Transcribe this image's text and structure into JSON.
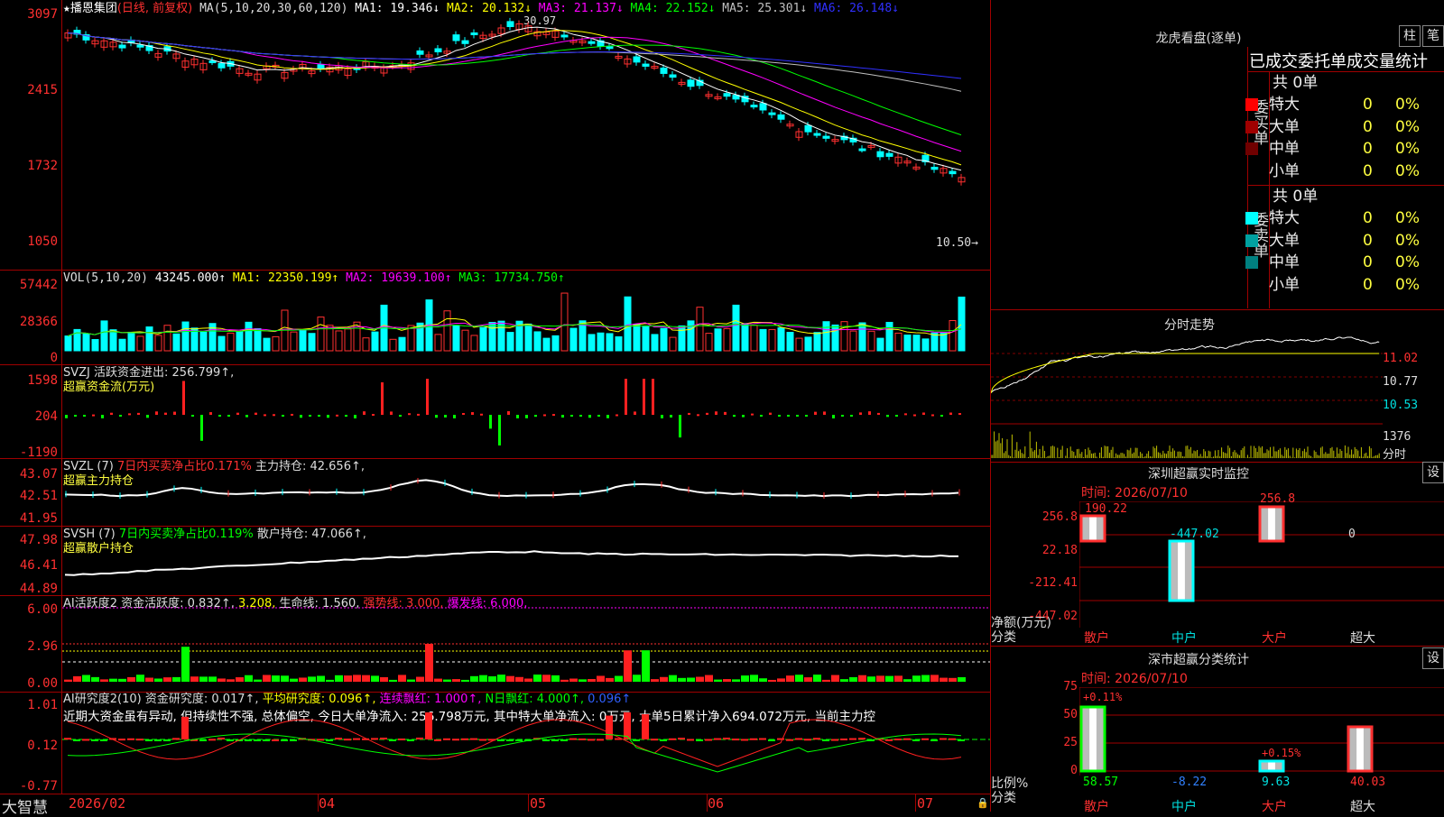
{
  "kline": {
    "title": "播恩集团",
    "period": "(日线, 前复权)",
    "ma_header": "MA(5,10,20,30,60,120)",
    "ma": [
      {
        "label": "MA1: 19.346↓",
        "color": "#ffffff"
      },
      {
        "label": "MA2: 20.132↓",
        "color": "#ffff00"
      },
      {
        "label": "MA3: 21.137↓",
        "color": "#ff00ff"
      },
      {
        "label": "MA4: 22.152↓",
        "color": "#00ff00"
      },
      {
        "label": "MA5: 25.301↓",
        "color": "#c0c0c0"
      },
      {
        "label": "MA6: 26.148↓",
        "color": "#3030ff"
      }
    ],
    "y_ticks": [
      "3097",
      "2415",
      "1732",
      "1050"
    ],
    "high_label": "30.97",
    "last_label": "10.50→"
  },
  "vol": {
    "header": "VOL(5,10,20)",
    "value": "43245.000↑",
    "ma": [
      {
        "label": "MA1: 22350.199↑",
        "color": "#ffff00"
      },
      {
        "label": "MA2: 19639.100↑",
        "color": "#ff00ff"
      },
      {
        "label": "MA3: 17734.750↑",
        "color": "#00ff00"
      }
    ],
    "y_ticks": [
      "57442",
      "28366",
      "0"
    ]
  },
  "svzj": {
    "header": "SVZJ  活跃资金进出: 256.799↑,",
    "sub": "超赢资金流(万元)",
    "y_ticks": [
      "1598",
      "204",
      "-1190"
    ]
  },
  "svzl": {
    "header_a": "SVZL (7)",
    "header_b": "7日内买卖净占比0.171%",
    "header_c": "主力持仓: 42.656↑,",
    "sub": "超赢主力持仓",
    "y_ticks": [
      "43.07",
      "42.51",
      "41.95"
    ]
  },
  "svsh": {
    "header_a": "SVSH (7)",
    "header_b": "7日内买卖净占比0.119%",
    "header_c": "散户持仓: 47.066↑,",
    "sub": "超赢散户持仓",
    "y_ticks": [
      "47.98",
      "46.41",
      "44.89"
    ]
  },
  "ai1": {
    "header_a": "AI活跃度2 资金活跃度: 0.832↑,",
    "header_b": "3.208,",
    "header_c": "生命线: 1.560,",
    "header_d": "强势线: 3.000,",
    "header_e": "爆发线: 6.000,",
    "y_ticks": [
      "6.00",
      "2.96",
      "0.00"
    ]
  },
  "ai2": {
    "header_a": "AI研究度2(10) 资金研究度: 0.017↑,",
    "header_b": "平均研究度: 0.096↑,",
    "header_c": "连续飘红: 1.000↑,",
    "header_d": "N日飘红: 4.000↑,",
    "header_e": "0.096↑",
    "commentary": "近期大资金虽有异动, 但持续性不强, 总体偏空, 今日大单净流入: 256.798万元, 其中特大单净流入: 0万元, 大单5日累计净入694.072万元, 当前主力控",
    "y_ticks": [
      "1.01",
      "0.12",
      "-0.77"
    ]
  },
  "bottom": {
    "brand": "大智慧",
    "dates": [
      "2026/02",
      "04",
      "05",
      "06",
      "07"
    ]
  },
  "right": {
    "dragon_title": "龙虎看盘(逐单)",
    "btn_zhu": "柱",
    "btn_bi": "笔",
    "tabs": [
      "已成交",
      "委托单",
      "成交量统计"
    ],
    "buy_label": "委买单",
    "sell_label": "委卖单",
    "buy_total": "共 0单",
    "sell_total": "共 0单",
    "buy_rows": [
      {
        "name": "特大",
        "count": "0",
        "pct": "0%",
        "color": "#ff0000"
      },
      {
        "name": "大单",
        "count": "0",
        "pct": "0%",
        "color": "#a00000"
      },
      {
        "name": "中单",
        "count": "0",
        "pct": "0%",
        "color": "#700000"
      },
      {
        "name": "小单",
        "count": "0",
        "pct": "0%",
        "color": ""
      }
    ],
    "sell_rows": [
      {
        "name": "特大",
        "count": "0",
        "pct": "0%",
        "color": "#00ffff"
      },
      {
        "name": "大单",
        "count": "0",
        "pct": "0%",
        "color": "#00a0a0"
      },
      {
        "name": "中单",
        "count": "0",
        "pct": "0%",
        "color": "#008080"
      },
      {
        "name": "小单",
        "count": "0",
        "pct": "0%",
        "color": ""
      }
    ],
    "fs_title": "分时走势",
    "fs_prices": [
      "11.02",
      "10.77",
      "10.53"
    ],
    "fs_vol": "1376",
    "fs_vol_label": "分时",
    "monitor_title": "深圳超赢实时监控",
    "monitor_setting": "设",
    "monitor_time": "时间: 2026/07/10",
    "monitor_y": [
      "256.8",
      "22.18",
      "-212.41",
      "-447.02"
    ],
    "monitor_bar_labels": [
      "190.22",
      "-447.02",
      "256.8",
      "0"
    ],
    "monitor_axis_left1": "净额(万元)",
    "monitor_axis_left2": "分类",
    "monitor_categories": [
      "散户",
      "中户",
      "大户",
      "超大"
    ],
    "stats_title": "深市超赢分类统计",
    "stats_setting": "设",
    "stats_time": "时间: 2026/07/10",
    "stats_y": [
      "75",
      "50",
      "25",
      "0"
    ],
    "stats_top_labels": [
      "+0.11%",
      "+0.15%"
    ],
    "stats_values": [
      "58.57",
      "-8.22",
      "9.63",
      "40.03"
    ],
    "stats_axis_left1": "比例%",
    "stats_axis_left2": "分类",
    "stats_categories": [
      "散户",
      "中户",
      "大户",
      "超大"
    ]
  }
}
